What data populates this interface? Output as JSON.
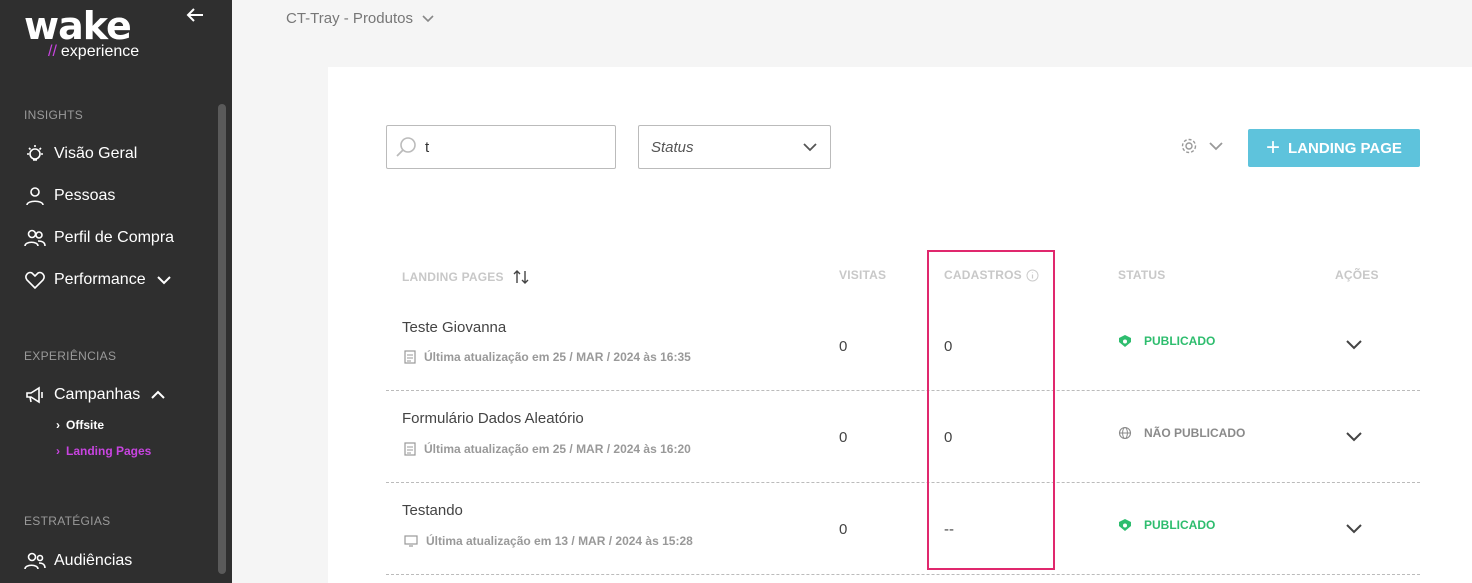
{
  "sidebar": {
    "logo_main": "wake",
    "logo_slashes": "//",
    "logo_sub": "experience",
    "sections": {
      "insights": "INSIGHTS",
      "experiencias": "EXPERIÊNCIAS",
      "estrategias": "ESTRATÉGIAS"
    },
    "items": {
      "visao_geral": "Visão Geral",
      "pessoas": "Pessoas",
      "perfil_compra": "Perfil de Compra",
      "performance": "Performance",
      "campanhas": "Campanhas",
      "offsite": "Offsite",
      "landing_pages": "Landing Pages",
      "audiencias": "Audiências"
    },
    "active_color": "#c844e0"
  },
  "header": {
    "workspace": "CT-Tray - Produtos"
  },
  "toolbar": {
    "search_value": "t",
    "status_placeholder": "Status",
    "add_button": "LANDING PAGE"
  },
  "table": {
    "headers": {
      "landing_pages": "LANDING PAGES",
      "visitas": "VISITAS",
      "cadastros": "CADASTROS",
      "status": "STATUS",
      "acoes": "AÇÕES"
    },
    "rows": [
      {
        "title": "Teste Giovanna",
        "meta": "Última atualização em 25 / MAR / 2024 às 16:35",
        "visitas": "0",
        "cadastros": "0",
        "status": "PUBLICADO"
      },
      {
        "title": "Formulário Dados Aleatório",
        "meta": "Última atualização em 25 / MAR / 2024 às 16:20",
        "visitas": "0",
        "cadastros": "0",
        "status": "NÃO PUBLICADO"
      },
      {
        "title": "Testando",
        "meta": "Última atualização em 13 / MAR / 2024 às 15:28",
        "visitas": "0",
        "cadastros": "--",
        "status": "PUBLICADO"
      }
    ]
  },
  "colors": {
    "published": "#2ebd6e",
    "unpublished": "#8a8a8a",
    "accent": "#5ec3dc",
    "highlight": "#e0286d"
  }
}
